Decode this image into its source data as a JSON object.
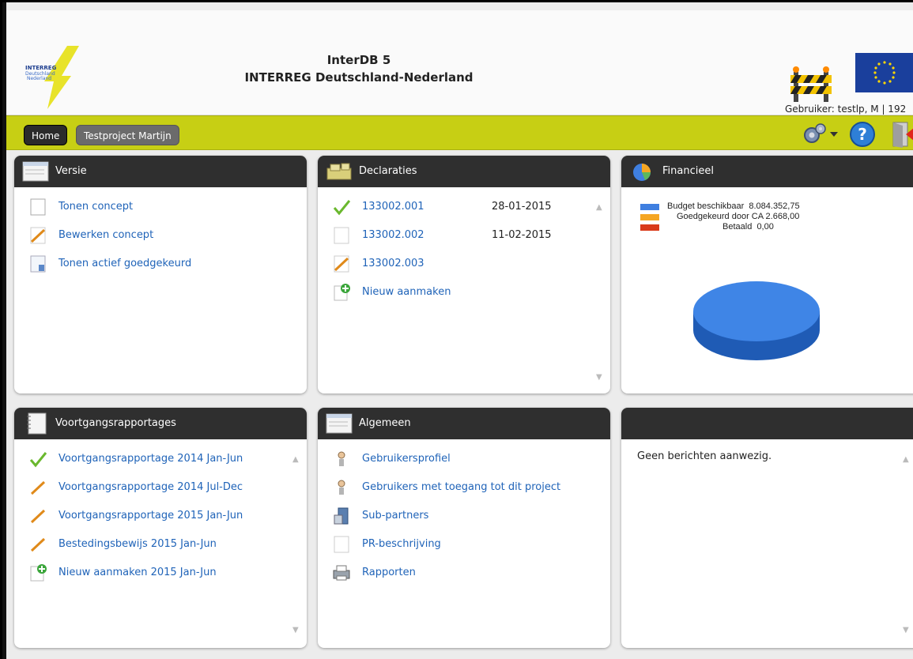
{
  "header": {
    "logo_text": [
      "INTERREG",
      "Deutschland",
      "Nederland"
    ],
    "title_line1": "InterDB 5",
    "title_line2": "INTERREG Deutschland-Nederland",
    "user_label": "Gebruiker: testlp, M | 192"
  },
  "nav": {
    "tabs": [
      {
        "label": "Home"
      },
      {
        "label": "Testproject Martijn"
      }
    ]
  },
  "panels": {
    "versie": {
      "title": "Versie",
      "items": [
        {
          "label": "Tonen concept",
          "icon": "document-icon"
        },
        {
          "label": "Bewerken concept",
          "icon": "edit-pencil-icon"
        },
        {
          "label": "Tonen actief goedgekeurd",
          "icon": "approved-document-icon"
        }
      ]
    },
    "declaraties": {
      "title": "Declaraties",
      "items": [
        {
          "label": "133002.001",
          "date": "28-01-2015",
          "icon": "checkmark-icon"
        },
        {
          "label": "133002.002",
          "date": "11-02-2015",
          "icon": "document-icon"
        },
        {
          "label": "133002.003",
          "date": "",
          "icon": "edit-pencil-icon"
        },
        {
          "label": "Nieuw aanmaken",
          "date": "",
          "icon": "add-new-icon"
        }
      ]
    },
    "financieel": {
      "title": "Financieel",
      "legend": [
        {
          "label": "Budget beschikbaar",
          "value": "8.084.352,75",
          "color": "#3f7fe0"
        },
        {
          "label": "Goedgekeurd door CA",
          "value": "2.668,00",
          "color": "#f5a623"
        },
        {
          "label": "Betaald",
          "value": "0,00",
          "color": "#d93a1a"
        }
      ]
    },
    "voortgang": {
      "title": "Voortgangsrapportages",
      "items": [
        {
          "label": "Voortgangsrapportage 2014 Jan-Jun",
          "icon": "checkmark-icon"
        },
        {
          "label": "Voortgangsrapportage 2014 Jul-Dec",
          "icon": "edit-pencil-icon"
        },
        {
          "label": "Voortgangsrapportage 2015 Jan-Jun",
          "icon": "edit-pencil-icon"
        },
        {
          "label": "Bestedingsbewijs 2015 Jan-Jun",
          "icon": "edit-pencil-icon"
        },
        {
          "label": "Nieuw aanmaken 2015 Jan-Jun",
          "icon": "add-new-icon"
        }
      ]
    },
    "algemeen": {
      "title": "Algemeen",
      "items": [
        {
          "label": "Gebruikersprofiel",
          "icon": "user-icon"
        },
        {
          "label": "Gebruikers met toegang tot dit project",
          "icon": "user-icon"
        },
        {
          "label": "Sub-partners",
          "icon": "server-icon"
        },
        {
          "label": "PR-beschrijving",
          "icon": "document-icon"
        },
        {
          "label": "Rapporten",
          "icon": "printer-icon"
        }
      ]
    },
    "berichten": {
      "title": "",
      "message": "Geen berichten aanwezig."
    }
  }
}
